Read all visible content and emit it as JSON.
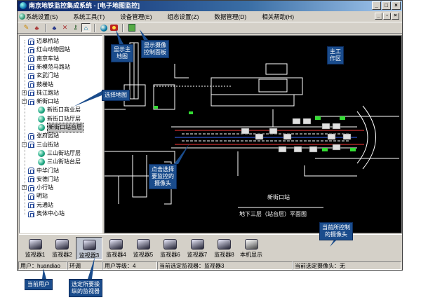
{
  "window": {
    "title": "南京地铁监控集成系统 - [电子地图监控]",
    "buttons": {
      "minimize": "_",
      "maximize": "□",
      "close": "×"
    },
    "mdi_buttons": {
      "minimize": "_",
      "restore": "▫",
      "close": "×"
    }
  },
  "menu": {
    "items": [
      "系统设置(S)",
      "系统工具(T)",
      "设备管理(E)",
      "组态设置(Z)",
      "数据管理(D)",
      "相关帮助(H)"
    ]
  },
  "toolbar": {
    "icons": [
      "pencil-icon",
      "users-icon",
      "group-icon",
      "cross-icon",
      "key-icon",
      "home-icon",
      "globe-icon",
      "camera-panel-icon",
      "exit-icon"
    ],
    "glyphs": [
      "✎",
      "♣",
      "♣",
      "✕",
      "⚷",
      "⌂"
    ]
  },
  "tree": {
    "items": [
      {
        "label": "迈皋桥站",
        "type": "station",
        "level": 0,
        "expander": ""
      },
      {
        "label": "红山动物园站",
        "type": "station",
        "level": 0,
        "expander": ""
      },
      {
        "label": "南京车站",
        "type": "station",
        "level": 0,
        "expander": ""
      },
      {
        "label": "新模范马路站",
        "type": "station",
        "level": 0,
        "expander": ""
      },
      {
        "label": "玄武门站",
        "type": "station",
        "level": 0,
        "expander": ""
      },
      {
        "label": "鼓楼站",
        "type": "station",
        "level": 0,
        "expander": ""
      },
      {
        "label": "珠江路站",
        "type": "station",
        "level": 0,
        "expander": "+"
      },
      {
        "label": "新街口站",
        "type": "station",
        "level": 0,
        "expander": "−"
      },
      {
        "label": "新街口商业层",
        "type": "map",
        "level": 1,
        "expander": ""
      },
      {
        "label": "新街口站厅层",
        "type": "map",
        "level": 1,
        "expander": ""
      },
      {
        "label": "新街口站台层",
        "type": "map",
        "level": 1,
        "expander": "",
        "selected": true
      },
      {
        "label": "张府园站",
        "type": "station",
        "level": 0,
        "expander": ""
      },
      {
        "label": "三山街站",
        "type": "station",
        "level": 0,
        "expander": "−"
      },
      {
        "label": "三山街站厅层",
        "type": "map",
        "level": 1,
        "expander": ""
      },
      {
        "label": "三山街站台层",
        "type": "map",
        "level": 1,
        "expander": ""
      },
      {
        "label": "中华门站",
        "type": "station",
        "level": 0,
        "expander": ""
      },
      {
        "label": "安德门站",
        "type": "station",
        "level": 0,
        "expander": ""
      },
      {
        "label": "小行站",
        "type": "station",
        "level": 0,
        "expander": "+"
      },
      {
        "label": "明站",
        "type": "station",
        "level": 0,
        "expander": ""
      },
      {
        "label": "元通站",
        "type": "station",
        "level": 0,
        "expander": ""
      },
      {
        "label": "奥体中心站",
        "type": "station",
        "level": 0,
        "expander": ""
      }
    ]
  },
  "map": {
    "station_name": "新街口站",
    "floor_title": "地下三层（站台层）平面图"
  },
  "monitors": {
    "items": [
      {
        "label": "监视器1"
      },
      {
        "label": "监视器2"
      },
      {
        "label": "监视器3",
        "selected": true
      },
      {
        "label": "监视器4"
      },
      {
        "label": "监视器5"
      },
      {
        "label": "监视器6"
      },
      {
        "label": "监视器7"
      },
      {
        "label": "监视器8"
      },
      {
        "label": "本机显示"
      }
    ]
  },
  "status": {
    "user": "用户：huandiao",
    "env": "环调",
    "level": "用户等级：4",
    "current_monitor": "当前选定监视器：监视器3",
    "current_camera": "当前选定摄像头：无"
  },
  "callouts": {
    "show_map": "显示主\n地图",
    "show_camera_panel": "显示摄像\n控制面板",
    "work_area": "主工\n作区",
    "select_map": "选择地图",
    "click_camera": "点击选择\n要监控的\n摄像头",
    "current_camera": "当前所控制\n的摄像头",
    "current_user": "当前用户",
    "select_monitor": "选定所要操\n纵的监视器"
  },
  "colors": {
    "title_start": "#0a246a",
    "callout_bg": "#1a4c8c",
    "map_bg": "#000000",
    "map_line": "#ffffff",
    "camera_green": "#33dd33"
  }
}
